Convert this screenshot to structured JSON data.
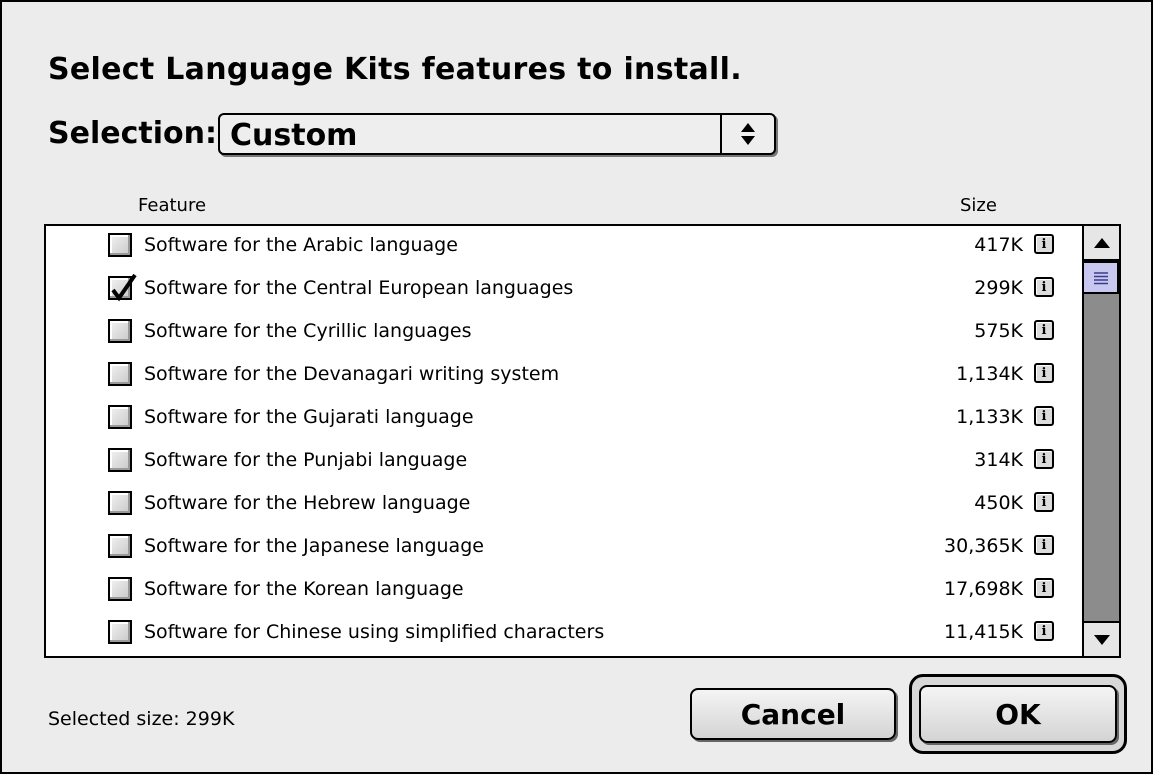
{
  "dialog": {
    "title": "Select Language Kits features to install."
  },
  "selection": {
    "label": "Selection:",
    "value": "Custom"
  },
  "list": {
    "columns": {
      "feature": "Feature",
      "size": "Size"
    },
    "info_glyph": "i",
    "items": [
      {
        "label": "Software for the Arabic language",
        "size": "417K",
        "checked": false
      },
      {
        "label": "Software for the Central European languages",
        "size": "299K",
        "checked": true
      },
      {
        "label": "Software for the Cyrillic languages",
        "size": "575K",
        "checked": false
      },
      {
        "label": "Software for the Devanagari writing system",
        "size": "1,134K",
        "checked": false
      },
      {
        "label": "Software for the Gujarati language",
        "size": "1,133K",
        "checked": false
      },
      {
        "label": "Software for the Punjabi language",
        "size": "314K",
        "checked": false
      },
      {
        "label": "Software for the Hebrew language",
        "size": "450K",
        "checked": false
      },
      {
        "label": "Software for the Japanese language",
        "size": "30,365K",
        "checked": false
      },
      {
        "label": "Software for the Korean language",
        "size": "17,698K",
        "checked": false
      },
      {
        "label": "Software for Chinese using simplified characters",
        "size": "11,415K",
        "checked": false
      }
    ]
  },
  "footer": {
    "selected_size": "Selected size: 299K",
    "cancel_label": "Cancel",
    "ok_label": "OK"
  },
  "icons": {
    "popup_arrows": "up-down-arrows-icon",
    "scroll_up": "scroll-up-arrow-icon",
    "scroll_down": "scroll-down-arrow-icon",
    "info": "info-icon",
    "check": "checkmark-icon"
  },
  "colors": {
    "dialog_bg": "#ececec",
    "scroll_track": "#8c8c8c",
    "scroll_thumb": "#c7c7f0"
  }
}
